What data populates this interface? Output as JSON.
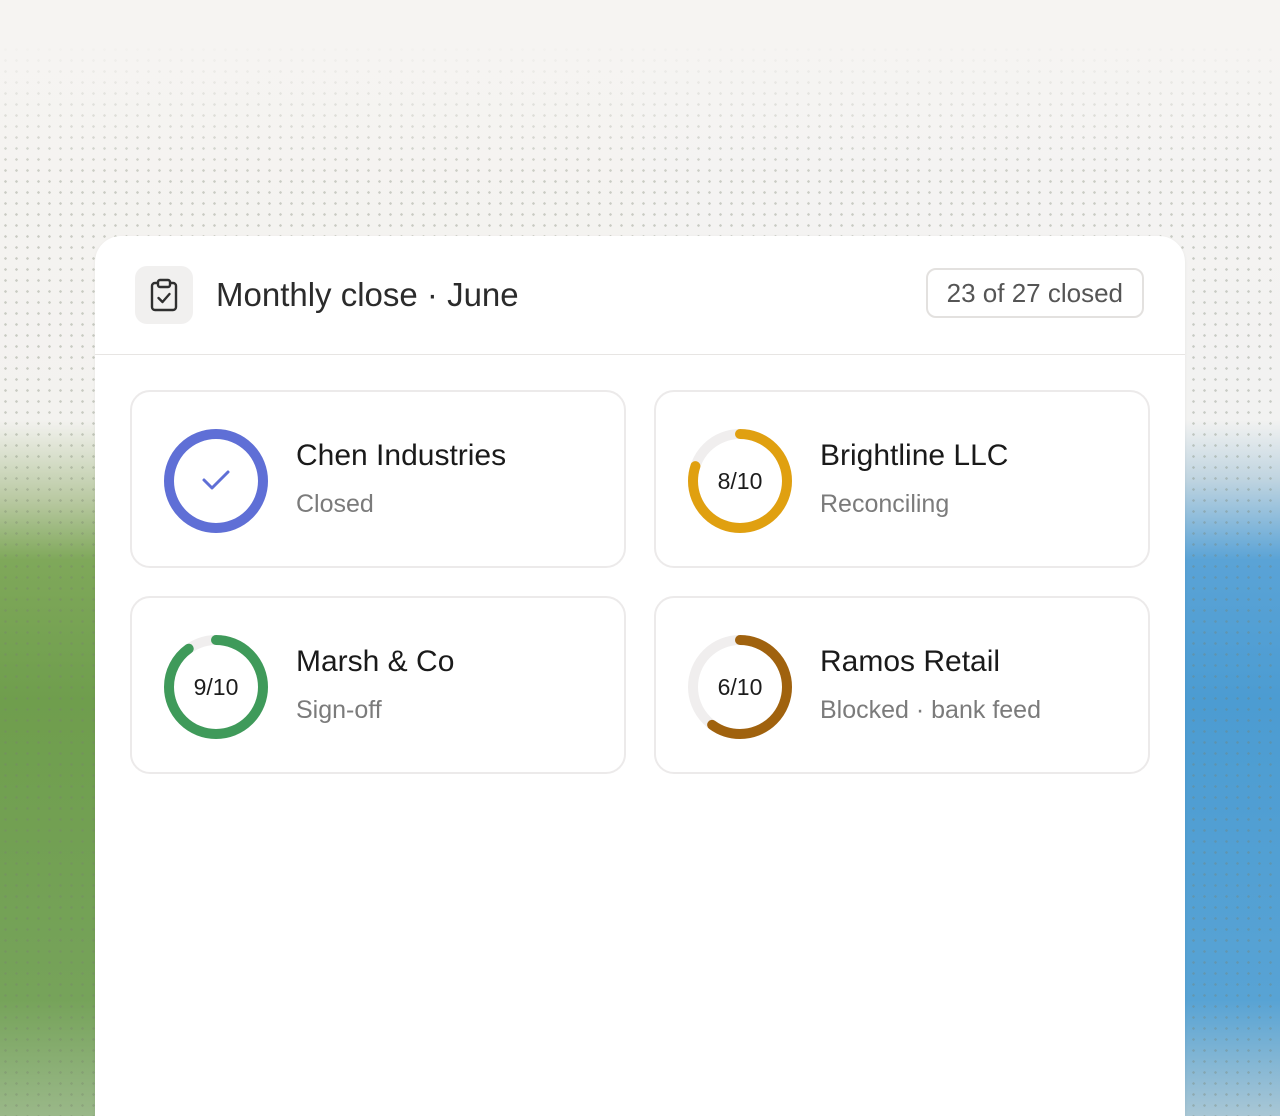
{
  "header": {
    "icon": "clipboard-check-icon",
    "title": "Monthly close · June",
    "closed_summary": "23 of 27 closed"
  },
  "colors": {
    "indigo": "#5f6fd6",
    "amber": "#e0a010",
    "green": "#3f9a5a",
    "brown": "#a0620e",
    "track": "#f0eeee"
  },
  "entities": [
    {
      "name": "Chen Industries",
      "status": "Closed",
      "progress_label": "",
      "done": 10,
      "total": 10,
      "color": "#5f6fd6",
      "icon": "check-icon"
    },
    {
      "name": "Brightline LLC",
      "status": "Reconciling",
      "progress_label": "8/10",
      "done": 8,
      "total": 10,
      "color": "#e0a010"
    },
    {
      "name": "Marsh & Co",
      "status": "Sign-off",
      "progress_label": "9/10",
      "done": 9,
      "total": 10,
      "color": "#3f9a5a"
    },
    {
      "name": "Ramos Retail",
      "status": "Blocked · bank feed",
      "progress_label": "6/10",
      "done": 6,
      "total": 10,
      "color": "#a0620e"
    }
  ]
}
